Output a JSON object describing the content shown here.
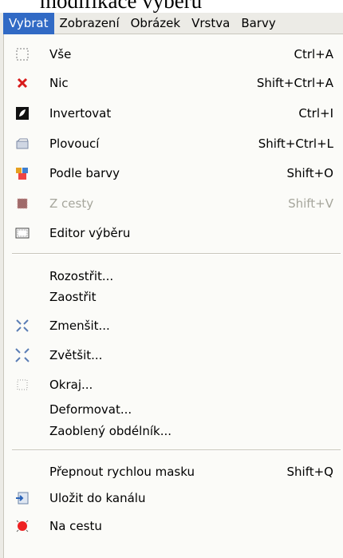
{
  "background_title": "modifikace výběru",
  "menubar": {
    "items": [
      "Vybrat",
      "Zobrazení",
      "Obrázek",
      "Vrstva",
      "Barvy"
    ],
    "active_index": 0
  },
  "menu": {
    "items": [
      {
        "label": "Vše",
        "shortcut": "Ctrl+A",
        "icon": "select-all-icon",
        "enabled": true
      },
      {
        "label": "Nic",
        "shortcut": "Shift+Ctrl+A",
        "icon": "red-x-icon",
        "enabled": true
      },
      {
        "label": "Invertovat",
        "shortcut": "Ctrl+I",
        "icon": "invert-icon",
        "enabled": true
      },
      {
        "label": "Plovoucí",
        "shortcut": "Shift+Ctrl+L",
        "icon": "float-icon",
        "enabled": true
      },
      {
        "label": "Podle barvy",
        "shortcut": "Shift+O",
        "icon": "select-by-color-icon",
        "enabled": true
      },
      {
        "label": "Z cesty",
        "shortcut": "Shift+V",
        "icon": "from-path-icon",
        "enabled": false
      },
      {
        "label": "Editor výběru",
        "shortcut": "",
        "icon": "selection-editor-icon",
        "enabled": true
      },
      {
        "label": "Rozostřit...",
        "shortcut": "",
        "icon": "",
        "enabled": true
      },
      {
        "label": "Zaostřit",
        "shortcut": "",
        "icon": "",
        "enabled": true
      },
      {
        "label": "Zmenšit...",
        "shortcut": "",
        "icon": "shrink-icon",
        "enabled": true
      },
      {
        "label": "Zvětšit...",
        "shortcut": "",
        "icon": "grow-icon",
        "enabled": true
      },
      {
        "label": "Okraj...",
        "shortcut": "",
        "icon": "border-icon",
        "enabled": true
      },
      {
        "label": "Deformovat...",
        "shortcut": "",
        "icon": "",
        "enabled": true
      },
      {
        "label": "Zaoblený obdélník...",
        "shortcut": "",
        "icon": "",
        "enabled": true
      },
      {
        "label": "Přepnout rychlou masku",
        "shortcut": "Shift+Q",
        "icon": "",
        "enabled": true
      },
      {
        "label": "Uložit do kanálu",
        "shortcut": "",
        "icon": "save-to-channel-icon",
        "enabled": true
      },
      {
        "label": "Na cestu",
        "shortcut": "",
        "icon": "to-path-icon",
        "enabled": true
      }
    ]
  },
  "colors": {
    "menubar_bg": "#ecebe6",
    "menu_bg": "#fbfbf8",
    "highlight": "#316ac5",
    "disabled_text": "#a6a69c",
    "red_x": "#d81b1b"
  }
}
